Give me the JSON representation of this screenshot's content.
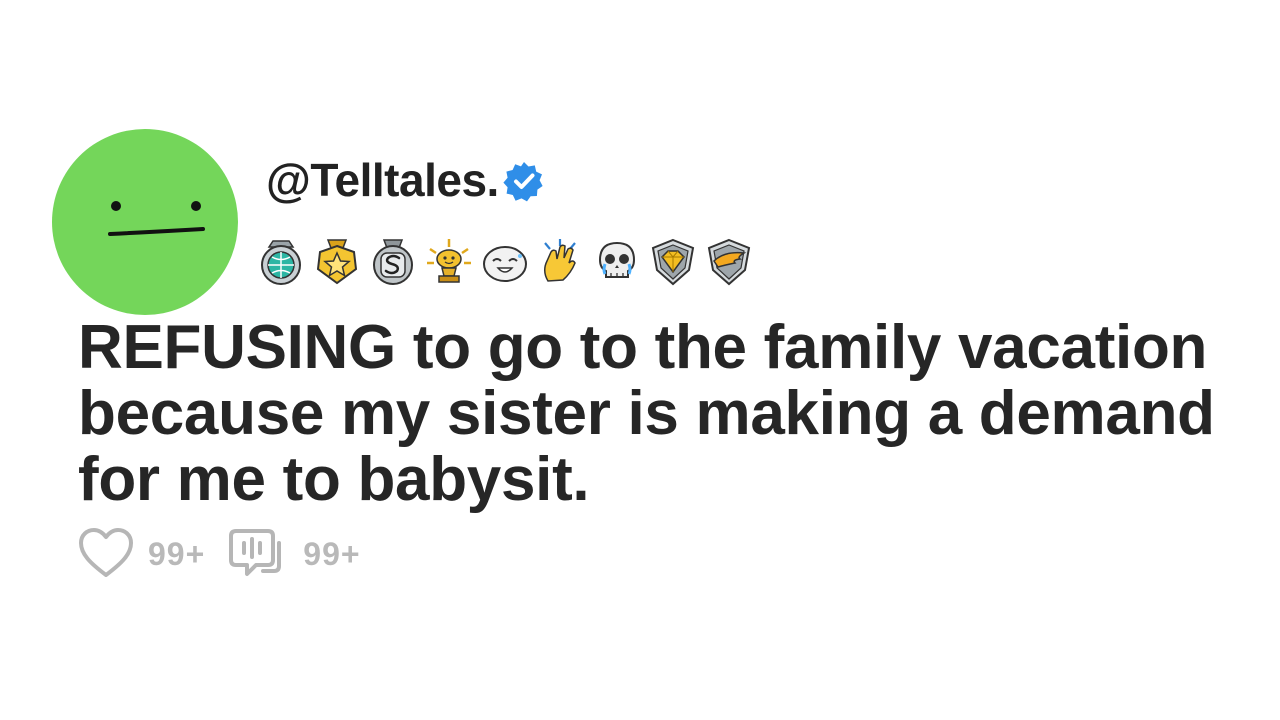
{
  "post": {
    "username": "@Telltales.",
    "verified": true,
    "title": "REFUSING to go to the family vacation because my sister is making a demand for me to babysit.",
    "likes": "99+",
    "comments": "99+"
  },
  "avatar": {
    "color": "#74d65a",
    "face": "neutral-face"
  },
  "badges": [
    {
      "icon": "globe-medal-icon"
    },
    {
      "icon": "gold-star-medal-icon"
    },
    {
      "icon": "silver-s-medal-icon"
    },
    {
      "icon": "gold-reddit-alien-trophy-icon"
    },
    {
      "icon": "laughing-face-icon"
    },
    {
      "icon": "clapping-hands-icon"
    },
    {
      "icon": "crying-skull-icon"
    },
    {
      "icon": "gold-gem-shield-icon"
    },
    {
      "icon": "gold-wing-shield-icon"
    }
  ],
  "colors": {
    "avatar": "#74d65a",
    "verified": "#2f8ee8",
    "headline": "#262626",
    "stats": "#b6b6b6"
  }
}
